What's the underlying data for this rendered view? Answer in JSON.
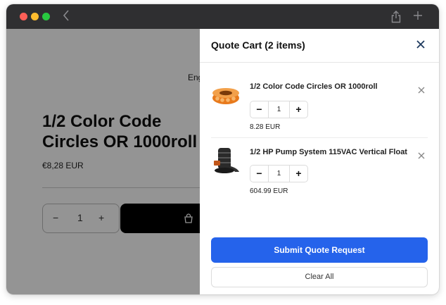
{
  "page": {
    "language_fragment": "Eng",
    "product_title": "1/2 Color Code Circles OR 1000roll",
    "product_price": "€8,28 EUR",
    "quantity": "1",
    "qty_minus": "−",
    "qty_plus": "+"
  },
  "drawer": {
    "title": "Quote Cart (2 items)",
    "items": [
      {
        "name": "1/2 Color Code Circles OR 1000roll",
        "quantity": "1",
        "price": "8.28 EUR",
        "minus": "−",
        "plus": "+"
      },
      {
        "name": "1/2 HP Pump System 115VAC Vertical Float",
        "quantity": "1",
        "price": "604.99 EUR",
        "minus": "−",
        "plus": "+"
      }
    ],
    "submit_label": "Submit Quote Request",
    "clear_label": "Clear All"
  },
  "colors": {
    "accent": "#2563eb",
    "titlebar": "#2f2f31",
    "traffic_red": "#fe5f57",
    "traffic_yellow": "#febc2e",
    "traffic_green": "#28c840"
  },
  "icons": {
    "back": "chevron-left-icon",
    "share": "share-icon",
    "new_tab": "plus-icon",
    "close": "close-icon",
    "remove": "close-icon",
    "add_to_cart": "cart-icon"
  }
}
